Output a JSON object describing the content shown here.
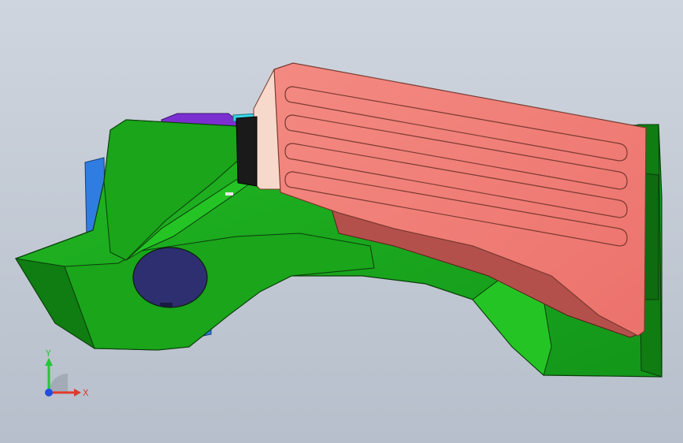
{
  "viewport": {
    "background_top": "#cfd5de",
    "background_bottom": "#b6bfcb"
  },
  "model": {
    "colors": {
      "body_green": "#1aa51a",
      "body_green_dark": "#0f7d12",
      "body_green_light": "#25c425",
      "edge": "#0b3d0b",
      "pad_salmon": "#ef7a73",
      "pad_salmon_dark": "#b4504c",
      "pad_side": "#f7d9cc",
      "purple": "#7b2fd0",
      "blue": "#2f7de0",
      "cyan": "#3ad6e8",
      "hole": "#2e2f70"
    },
    "grip_ribs": 4
  },
  "triad": {
    "y_label": "Y",
    "x_label": "X",
    "y_color": "#27c43a",
    "x_color": "#e03a2e",
    "z_color": "#1f4fe0"
  }
}
